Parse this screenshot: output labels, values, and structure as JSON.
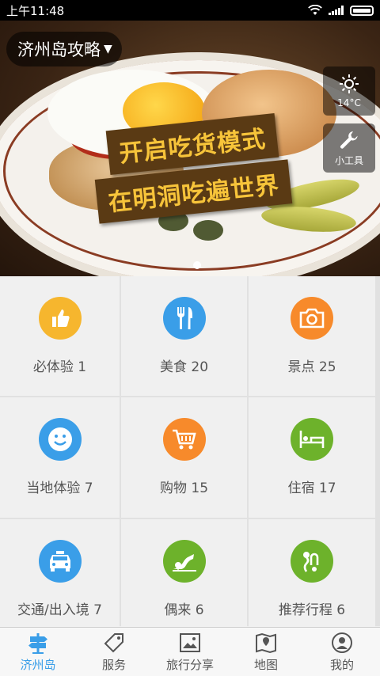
{
  "status_bar": {
    "time": "上午11:48"
  },
  "banner": {
    "city": "济州岛攻略",
    "tagline_1": "开启吃货模式",
    "tagline_2": "在明洞吃遍世界",
    "weather": {
      "temperature": "14°C",
      "icon": "sun-icon"
    },
    "tools": {
      "label": "小工具",
      "icon": "wrench-icon"
    }
  },
  "categories": [
    {
      "label": "必体验 1",
      "icon": "thumbs-up-icon",
      "color": "#f6b62e"
    },
    {
      "label": "美食 20",
      "icon": "fork-knife-icon",
      "color": "#3a9ee8"
    },
    {
      "label": "景点 25",
      "icon": "camera-icon",
      "color": "#f78a2b"
    },
    {
      "label": "当地体验 7",
      "icon": "smiley-icon",
      "color": "#3a9ee8"
    },
    {
      "label": "购物 15",
      "icon": "cart-icon",
      "color": "#f78a2b"
    },
    {
      "label": "住宿 17",
      "icon": "bed-icon",
      "color": "#6db22b"
    },
    {
      "label": "交通/出入境 7",
      "icon": "car-icon",
      "color": "#3a9ee8"
    },
    {
      "label": "偶来 6",
      "icon": "trail-icon",
      "color": "#6db22b"
    },
    {
      "label": "推荐行程 6",
      "icon": "route-icon",
      "color": "#6db22b"
    }
  ],
  "tabbar": [
    {
      "label": "济州岛",
      "icon": "signpost-icon",
      "active": true
    },
    {
      "label": "服务",
      "icon": "tag-icon",
      "active": false
    },
    {
      "label": "旅行分享",
      "icon": "picture-icon",
      "active": false
    },
    {
      "label": "地图",
      "icon": "map-icon",
      "active": false
    },
    {
      "label": "我的",
      "icon": "user-icon",
      "active": false
    }
  ]
}
